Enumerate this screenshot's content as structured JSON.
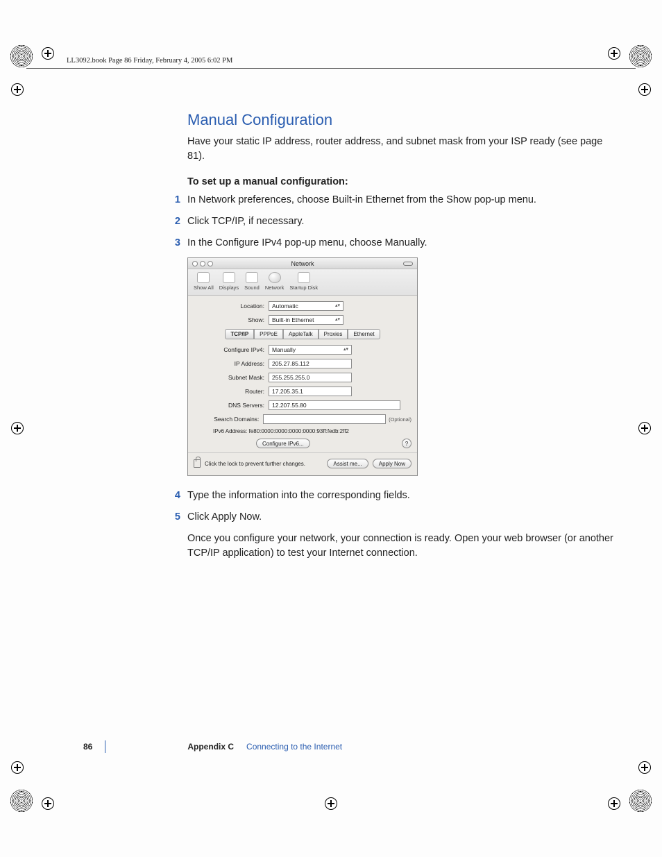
{
  "header_line": "LL3092.book  Page 86  Friday, February 4, 2005  6:02 PM",
  "section_title": "Manual Configuration",
  "intro_para": "Have your static IP address, router address, and subnet mask from your ISP ready (see page 81).",
  "subhead": "To set up a manual configuration:",
  "steps_top": [
    "In Network preferences, choose Built-in Ethernet from the Show pop-up menu.",
    "Click TCP/IP, if necessary.",
    "In the Configure IPv4 pop-up menu, choose Manually."
  ],
  "steps_bottom": [
    "Type the information into the corresponding fields.",
    "Click Apply Now."
  ],
  "closing_para": "Once you configure your network, your connection is ready. Open your web browser (or another TCP/IP application) to test your Internet connection.",
  "prefpane": {
    "window_title": "Network",
    "toolbar": [
      "Show All",
      "Displays",
      "Sound",
      "Network",
      "Startup Disk"
    ],
    "location_label": "Location:",
    "location_value": "Automatic",
    "show_label": "Show:",
    "show_value": "Built-in Ethernet",
    "tabs": [
      "TCP/IP",
      "PPPoE",
      "AppleTalk",
      "Proxies",
      "Ethernet"
    ],
    "active_tab": "TCP/IP",
    "configure_label": "Configure IPv4:",
    "configure_value": "Manually",
    "ip_label": "IP Address:",
    "ip_value": "205.27.85.112",
    "subnet_label": "Subnet Mask:",
    "subnet_value": "255.255.255.0",
    "router_label": "Router:",
    "router_value": "17.205.35.1",
    "dns_label": "DNS Servers:",
    "dns_value": "12.207.55.80",
    "search_label": "Search Domains:",
    "search_value": "",
    "search_optional": "(Optional)",
    "ipv6_label": "IPv6 Address:",
    "ipv6_value": "fe80:0000:0000:0000:0000:93ff:fedb:2ff2",
    "configure_ipv6_btn": "Configure IPv6...",
    "lock_text": "Click the lock to prevent further changes.",
    "assist_btn": "Assist me...",
    "apply_btn": "Apply Now",
    "help_label": "?"
  },
  "footer": {
    "page_number": "86",
    "appendix_label": "Appendix C",
    "appendix_title": "Connecting to the Internet"
  }
}
